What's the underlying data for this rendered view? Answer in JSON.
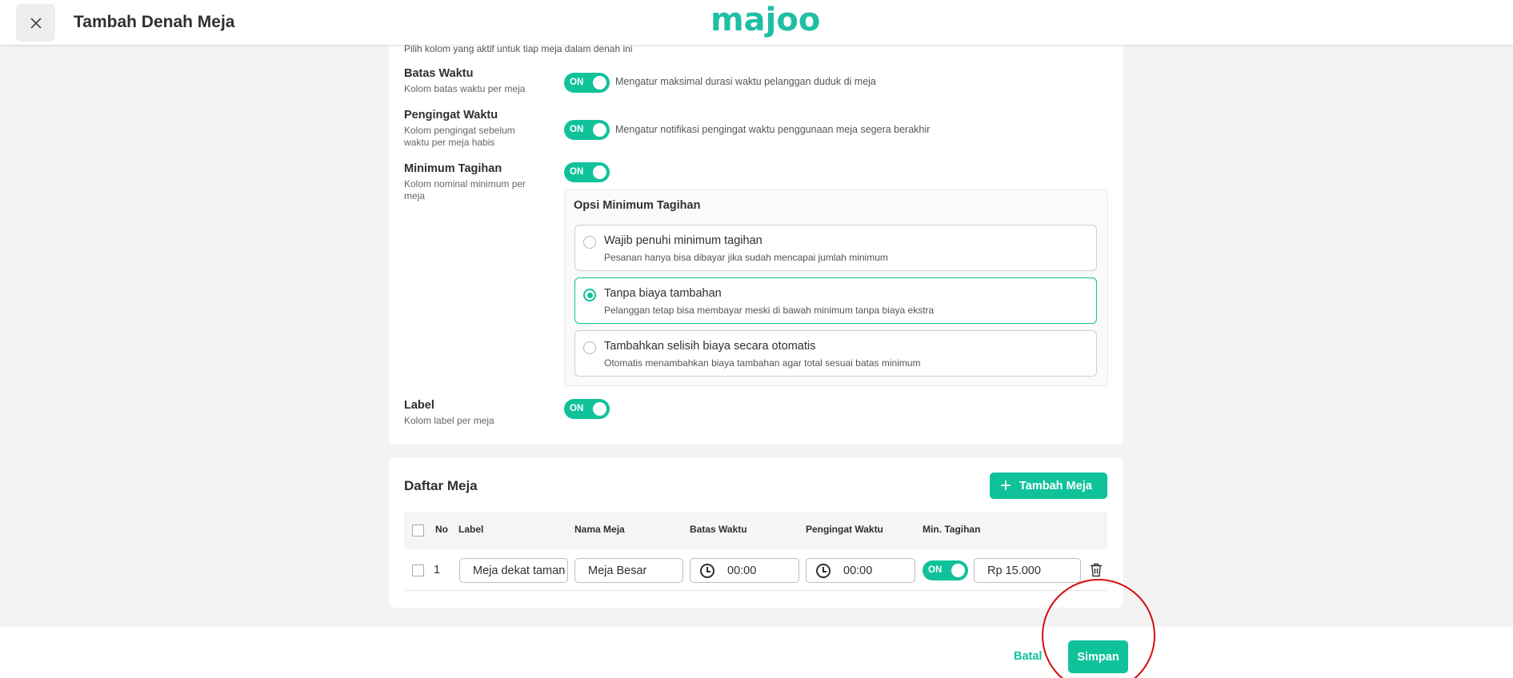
{
  "header": {
    "title": "Tambah Denah Meja",
    "logo_text": "majoo",
    "close_icon": "close-icon"
  },
  "columns_section": {
    "hint": "Pilih kolom yang aktif untuk tiap meja dalam denah ini",
    "batas_waktu": {
      "title": "Batas Waktu",
      "desc": "Kolom batas waktu per meja",
      "toggle": "ON",
      "toggle_desc": "Mengatur maksimal durasi waktu pelanggan duduk di meja"
    },
    "pengingat_waktu": {
      "title": "Pengingat Waktu",
      "desc_line1": "Kolom pengingat sebelum",
      "desc_line2": "waktu per meja habis",
      "toggle": "ON",
      "toggle_desc": "Mengatur notifikasi pengingat waktu penggunaan meja segera berakhir"
    },
    "minimum_tagihan": {
      "title": "Minimum Tagihan",
      "desc_line1": "Kolom nominal minimum per",
      "desc_line2": "meja",
      "toggle": "ON",
      "options_title": "Opsi Minimum Tagihan",
      "options": [
        {
          "title": "Wajib penuhi minimum tagihan",
          "desc": "Pesanan hanya bisa dibayar jika sudah mencapai jumlah minimum",
          "selected": false
        },
        {
          "title": "Tanpa biaya tambahan",
          "desc": "Pelanggan tetap bisa membayar meski di bawah minimum tanpa biaya ekstra",
          "selected": true
        },
        {
          "title": "Tambahkan selisih biaya secara otomatis",
          "desc": "Otomatis menambahkan biaya tambahan agar total sesuai batas minimum",
          "selected": false
        }
      ]
    },
    "label": {
      "title": "Label",
      "desc": "Kolom label per meja",
      "toggle": "ON"
    }
  },
  "daftar_meja": {
    "title": "Daftar Meja",
    "add_button": "Tambah Meja",
    "headers": [
      "No",
      "Label",
      "Nama Meja",
      "Batas Waktu",
      "Pengingat Waktu",
      "Min. Tagihan"
    ],
    "rows": [
      {
        "no": "1",
        "label": "Meja dekat taman",
        "nama_meja": "Meja Besar",
        "batas_waktu": "00:00",
        "pengingat_waktu": "00:00",
        "min_tagihan_toggle": "ON",
        "min_tagihan": "Rp 15.000"
      }
    ]
  },
  "footer": {
    "cancel": "Batal",
    "save": "Simpan"
  },
  "colors": {
    "accent": "#10c29a",
    "highlight": "#d20e0e"
  }
}
